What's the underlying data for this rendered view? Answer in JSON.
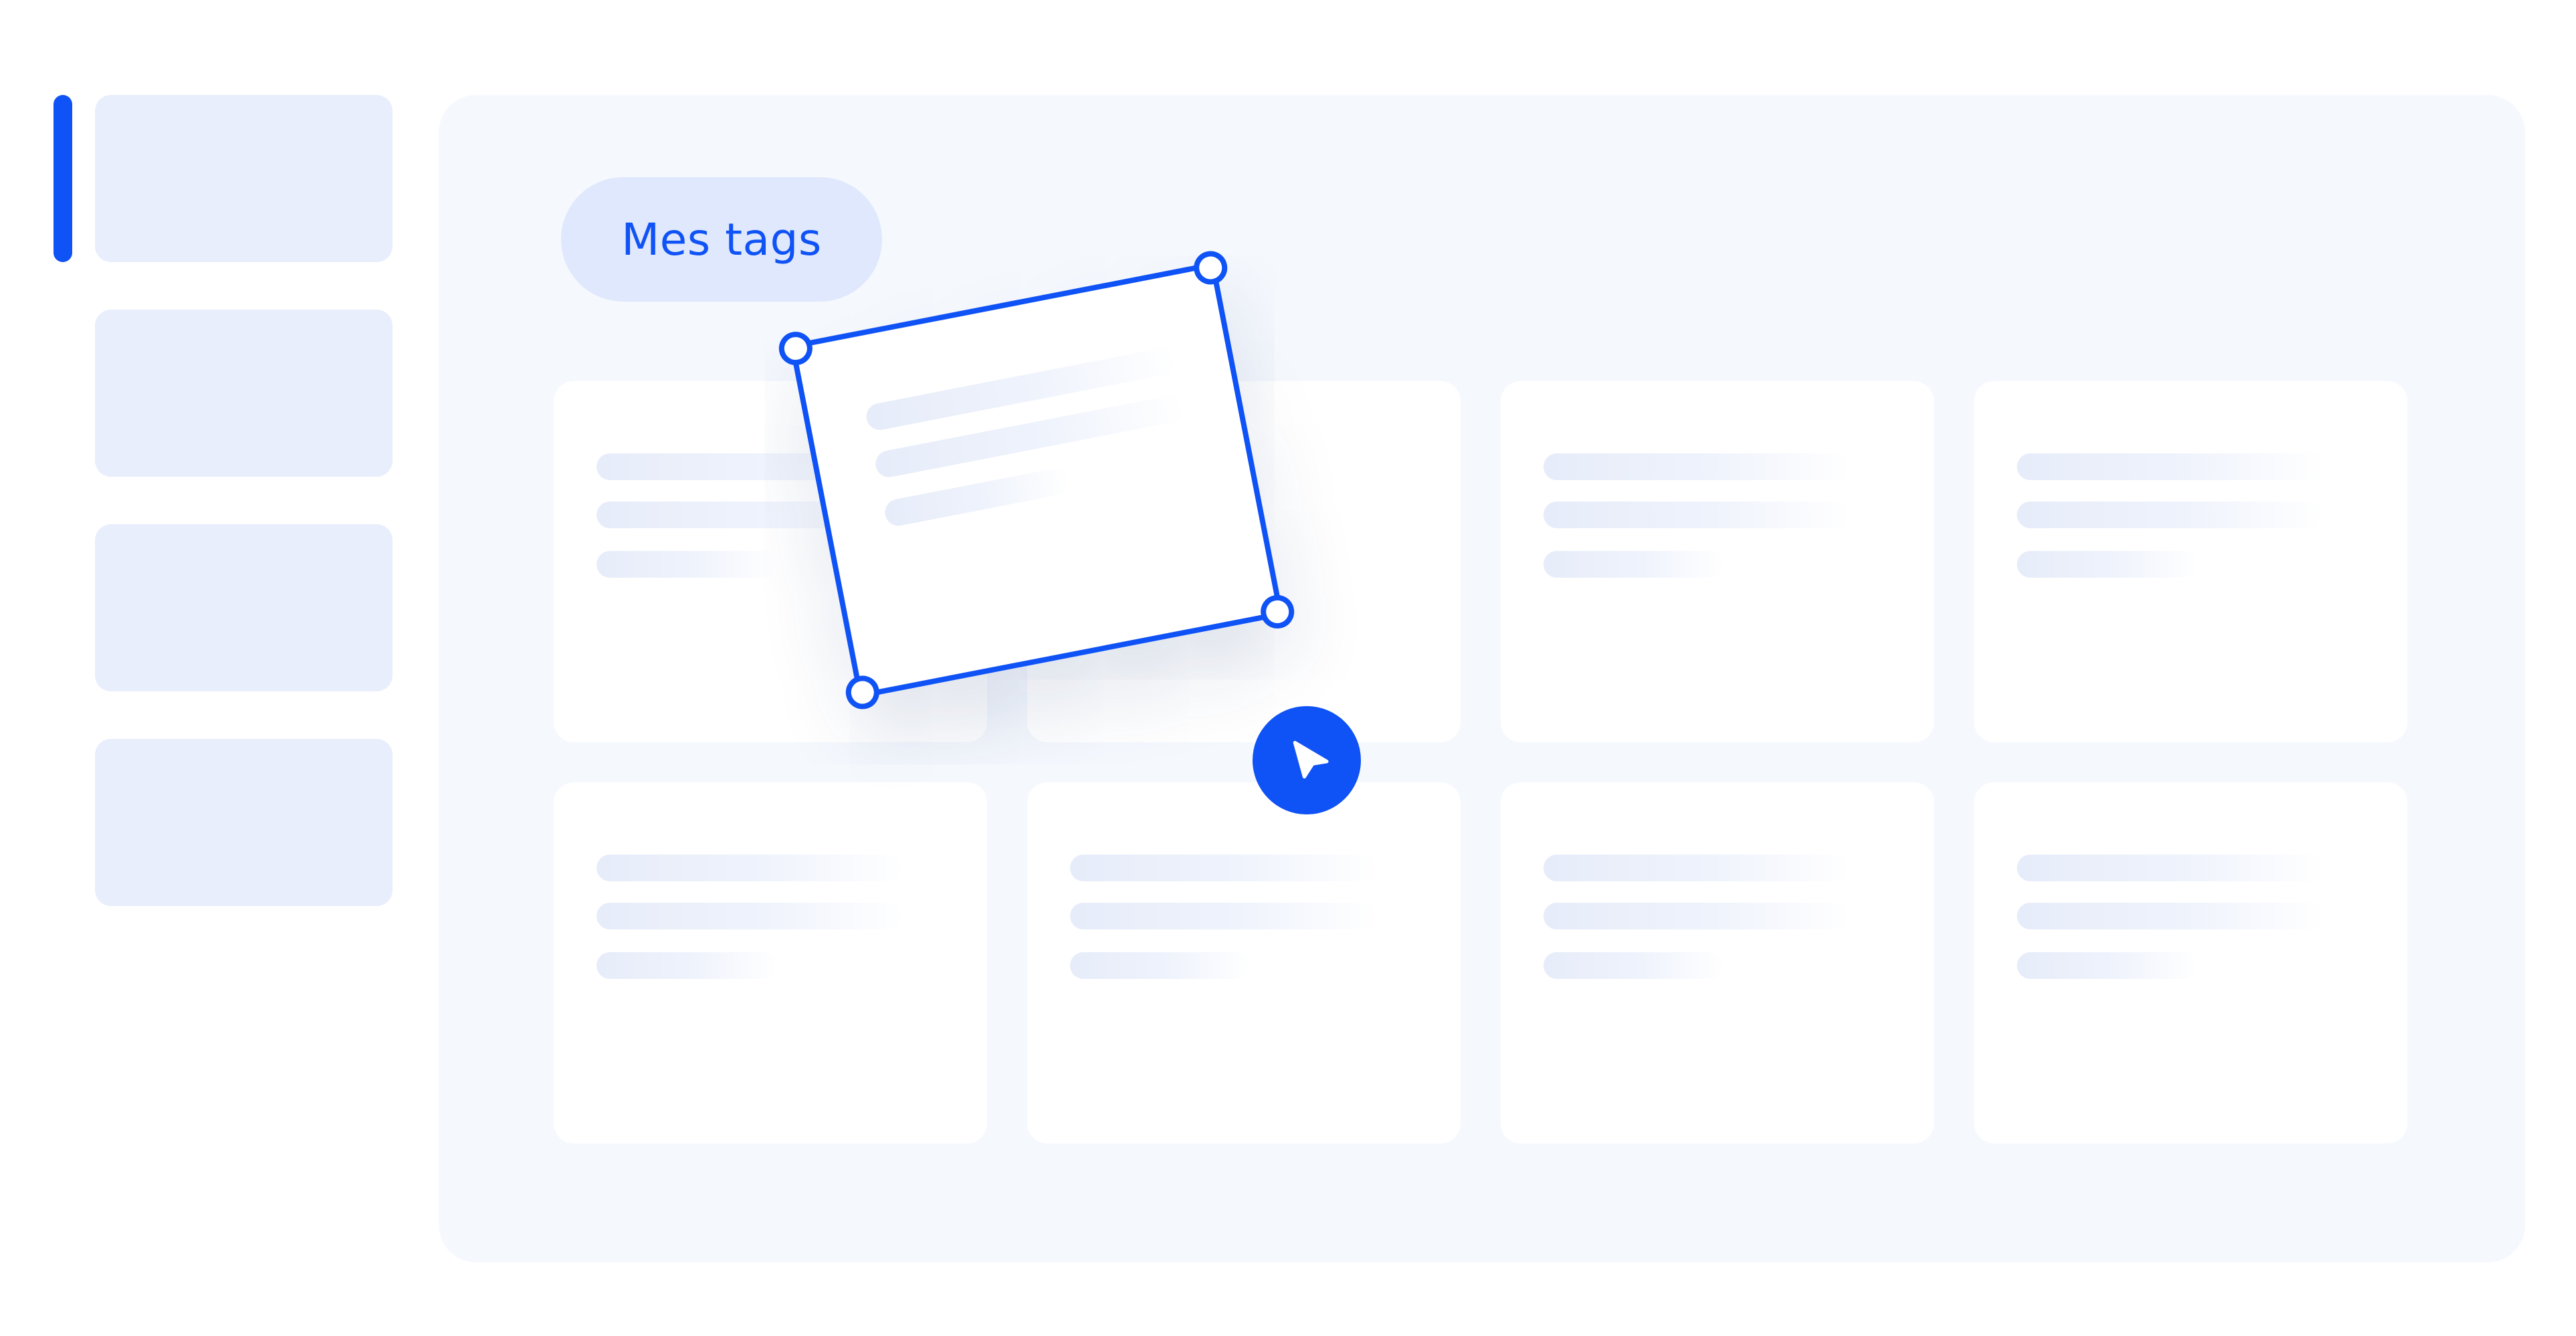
{
  "tags": {
    "label": "Mes tags"
  },
  "colors": {
    "accent": "#0f52f5",
    "panel_bg": "#f5f8fd",
    "sidebar_item_bg": "#e8eefb",
    "tag_pill_bg": "#dfe8fc",
    "card_bg": "#ffffff"
  },
  "icons": {
    "cursor": "cursor-arrow-icon",
    "handle": "resize-handle-icon"
  }
}
